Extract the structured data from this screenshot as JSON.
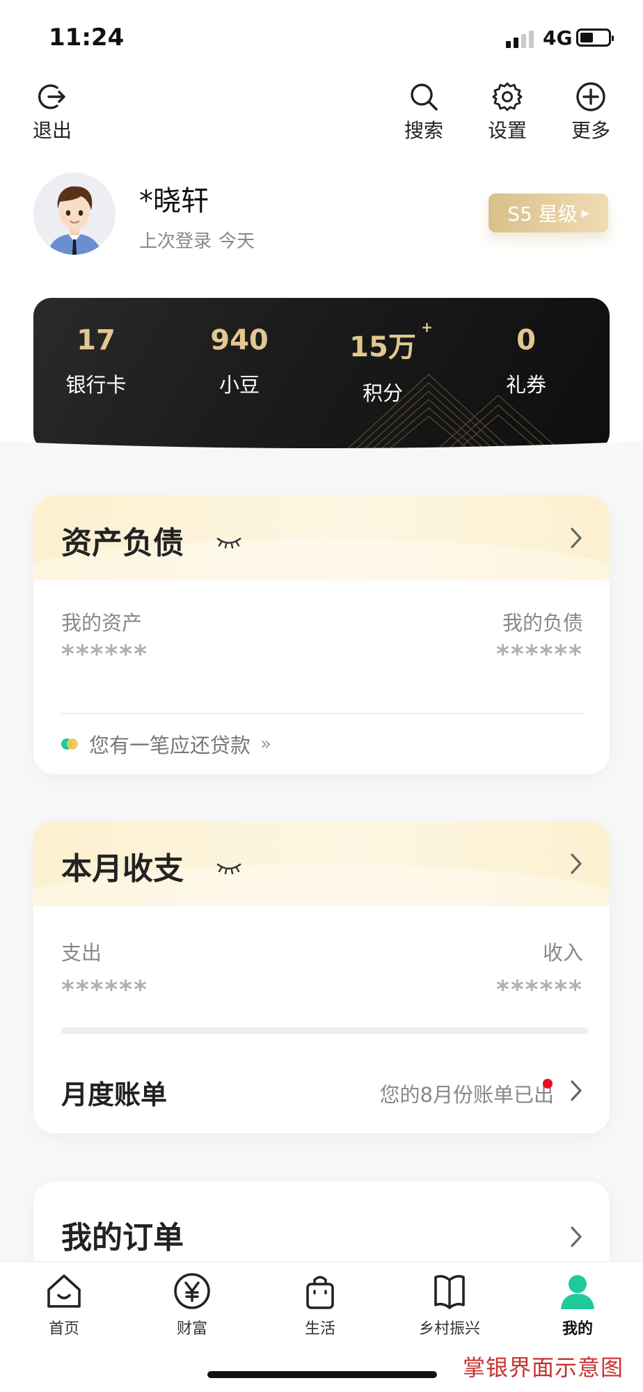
{
  "status_bar": {
    "time": "11:24",
    "network": "4G"
  },
  "header": {
    "exit_label": "退出",
    "search_label": "搜索",
    "settings_label": "设置",
    "more_label": "更多"
  },
  "user": {
    "name": "*晓轩",
    "last_login_label": "上次登录",
    "last_login_value": "今天",
    "level_badge": "S5 星级"
  },
  "stats": [
    {
      "value": "17",
      "label": "银行卡"
    },
    {
      "value": "940",
      "label": "小豆"
    },
    {
      "value": "15万",
      "label": "积分",
      "superscript": "+"
    },
    {
      "value": "0",
      "label": "礼券"
    }
  ],
  "assets_card": {
    "title": "资产负债",
    "assets_label": "我的资产",
    "liabilities_label": "我的负债",
    "assets_value": "******",
    "liabilities_value": "******",
    "notice": "您有一笔应还贷款"
  },
  "monthly_card": {
    "title": "本月收支",
    "expense_label": "支出",
    "income_label": "收入",
    "expense_value": "******",
    "income_value": "******",
    "bill_label": "月度账单",
    "bill_note": "您的8月份账单已出"
  },
  "orders_card": {
    "title": "我的订单"
  },
  "tabbar": {
    "items": [
      {
        "label": "首页",
        "icon": "home-icon"
      },
      {
        "label": "财富",
        "icon": "yuan-icon"
      },
      {
        "label": "生活",
        "icon": "shopping-bag-icon"
      },
      {
        "label": "乡村振兴",
        "icon": "book-icon"
      },
      {
        "label": "我的",
        "icon": "person-icon",
        "active": true
      }
    ]
  },
  "watermark": "掌银界面示意图",
  "colors": {
    "accent_green": "#1fc99a",
    "gold": "#e2c88f",
    "notice_dot_yellow": "#f2c94c"
  }
}
